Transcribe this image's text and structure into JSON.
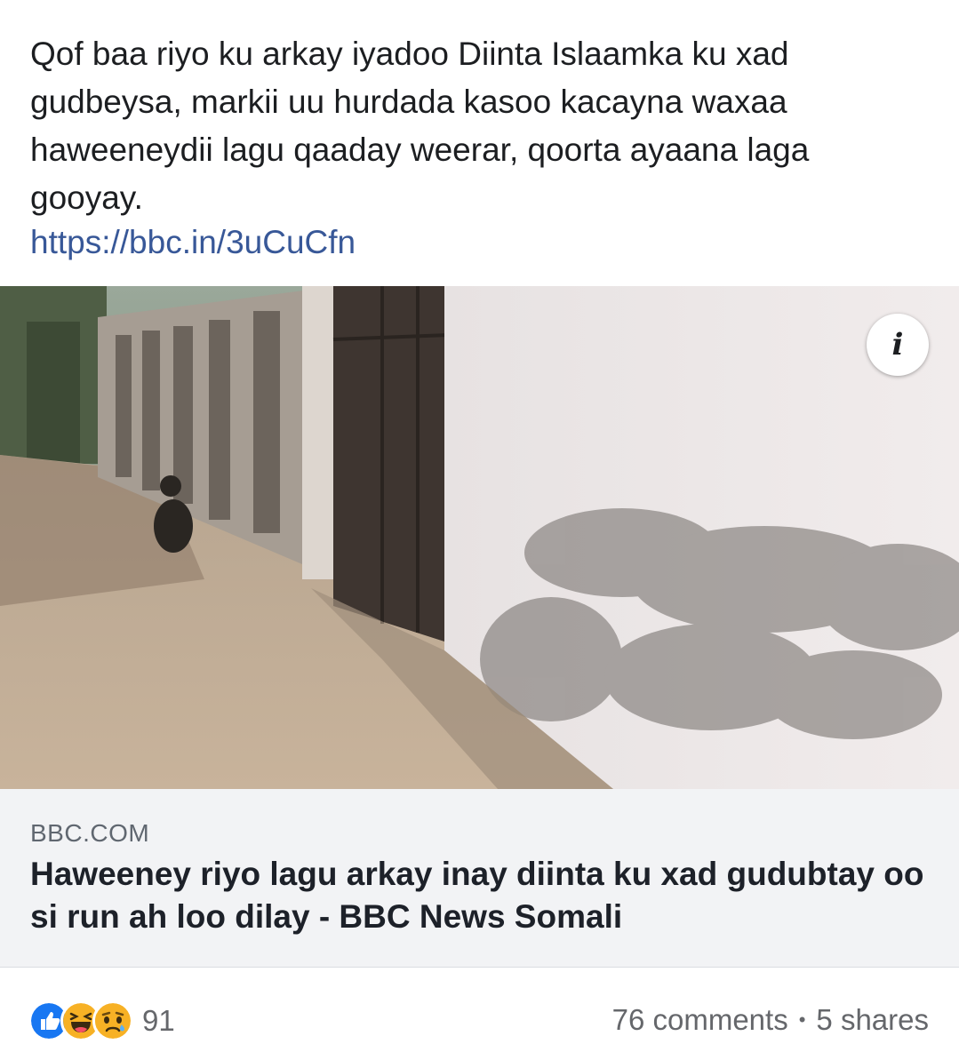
{
  "post": {
    "text": "Qof baa riyo ku arkay iyadoo Diinta Islaamka ku xad gudbeysa, markii uu hurdada kasoo kacayna waxaa haweeneydii lagu qaaday weerar, qoorta ayaana laga gooyay.",
    "link": "https://bbc.in/3uCuCfn"
  },
  "photo": {
    "info_icon": "info-icon"
  },
  "link_card": {
    "domain": "BBC.COM",
    "title": "Haweeney riyo lagu arkay inay diinta ku xad gudubtay oo si run ah loo dilay - BBC News Somali"
  },
  "footer": {
    "reaction_icons": [
      "like-icon",
      "haha-icon",
      "sad-icon"
    ],
    "reaction_count": "91",
    "comments": "76 comments",
    "separator": "•",
    "shares": "5 shares"
  },
  "colors": {
    "link": "#385898",
    "like": "#1877f2",
    "haha": "#f7b125",
    "muted": "#65676b"
  }
}
